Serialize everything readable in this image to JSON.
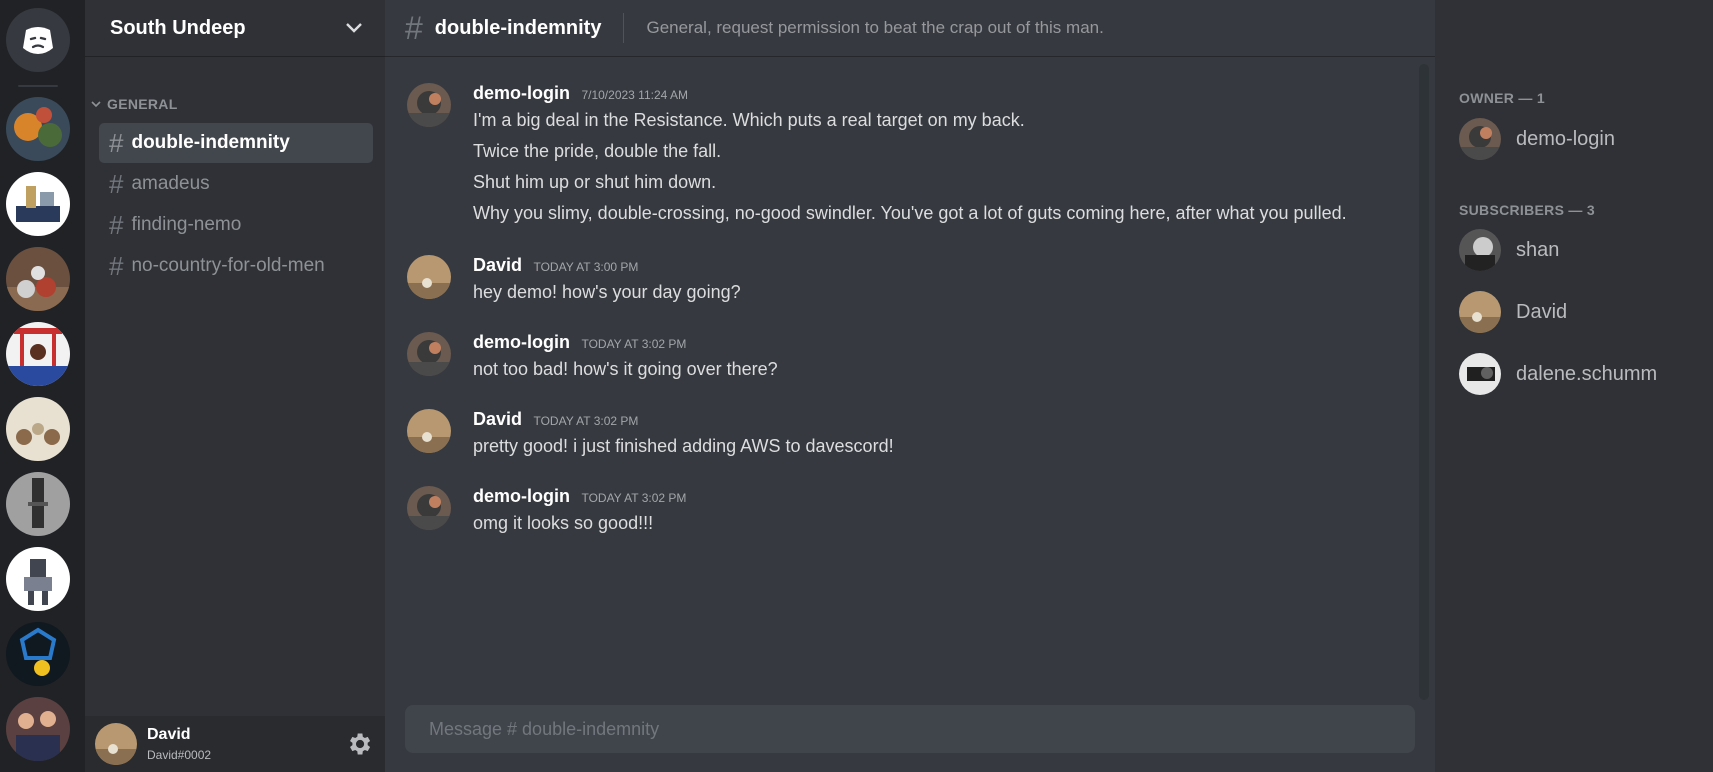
{
  "server_rail": {
    "home_icon": "discord-logo-icon",
    "servers": [
      {
        "name": "server-1",
        "colors": [
          "#3a4a5a",
          "#d8842a",
          "#4b6a3a"
        ]
      },
      {
        "name": "server-2",
        "colors": [
          "#ffffff",
          "#2a3a5a",
          "#c0a060"
        ]
      },
      {
        "name": "server-3",
        "colors": [
          "#6b5040",
          "#d0d0d0",
          "#b04030"
        ]
      },
      {
        "name": "server-4",
        "colors": [
          "#f2f2f2",
          "#c83030",
          "#2a4aa0"
        ]
      },
      {
        "name": "server-5",
        "colors": [
          "#e8e0d0",
          "#8a6a4a",
          "#bba888"
        ]
      },
      {
        "name": "server-6",
        "colors": [
          "#a0a0a0",
          "#303030",
          "#c8c8c8"
        ]
      },
      {
        "name": "server-7",
        "colors": [
          "#ffffff",
          "#404550",
          "#7a8090"
        ]
      },
      {
        "name": "server-8",
        "colors": [
          "#101820",
          "#2a7acc",
          "#f0c020"
        ]
      },
      {
        "name": "server-9",
        "colors": [
          "#5a4040",
          "#e0b090",
          "#2a3050"
        ]
      }
    ]
  },
  "sidebar": {
    "server_name": "South Undeep",
    "category": "GENERAL",
    "channels": [
      {
        "name": "double-indemnity",
        "active": true
      },
      {
        "name": "amadeus",
        "active": false
      },
      {
        "name": "finding-nemo",
        "active": false
      },
      {
        "name": "no-country-for-old-men",
        "active": false
      }
    ],
    "user": {
      "name": "David",
      "tag": "David#0002"
    }
  },
  "chat": {
    "channel": "double-indemnity",
    "topic": "General, request permission to beat the crap out of this man.",
    "composer_placeholder": "Message # double-indemnity",
    "messages": [
      {
        "author": "demo-login",
        "timestamp": "7/10/2023 11:24 AM",
        "lines": [
          "I'm a big deal in the Resistance. Which puts a real target on my back.",
          "Twice the pride, double the fall.",
          "Shut him up or shut him down.",
          "Why you slimy, double-crossing, no-good swindler. You've got a lot of guts coming here, after what you pulled."
        ]
      },
      {
        "author": "David",
        "timestamp": "TODAY AT 3:00 PM",
        "lines": [
          "hey demo! how's your day going?"
        ]
      },
      {
        "author": "demo-login",
        "timestamp": "TODAY AT 3:02 PM",
        "lines": [
          "not too bad! how's it going over there?"
        ]
      },
      {
        "author": "David",
        "timestamp": "TODAY AT 3:02 PM",
        "lines": [
          "pretty good! i just finished adding AWS to davescord!"
        ]
      },
      {
        "author": "demo-login",
        "timestamp": "TODAY AT 3:02 PM",
        "lines": [
          "omg it looks so good!!!"
        ]
      }
    ]
  },
  "members": {
    "owner_header": "OWNER — 1",
    "owners": [
      "demo-login"
    ],
    "subscribers_header": "SUBSCRIBERS — 3",
    "subscribers": [
      "shan",
      "David",
      "dalene.schumm"
    ]
  },
  "colors": {
    "rail": "#202225",
    "sidebar": "#2f3136",
    "chat": "#36393f",
    "active_channel": "#42464d"
  }
}
